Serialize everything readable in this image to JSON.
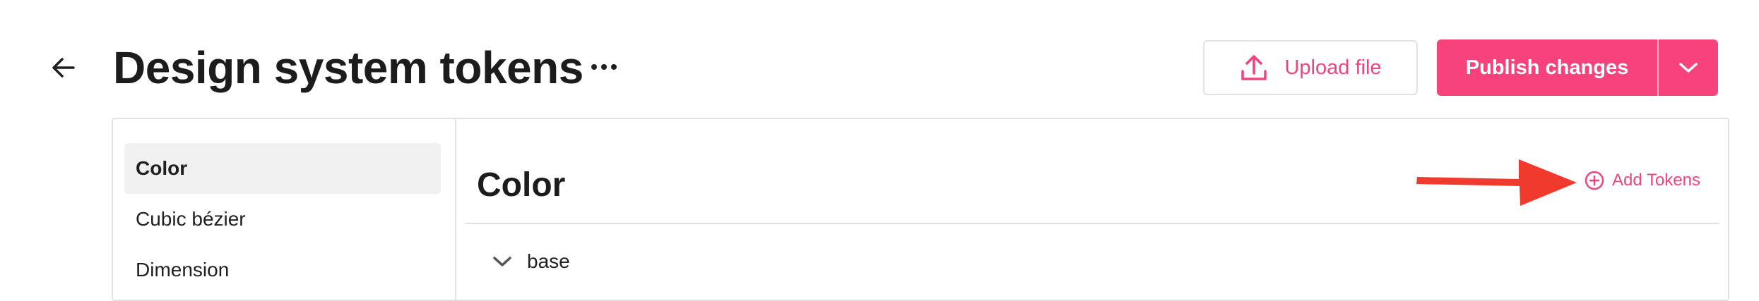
{
  "header": {
    "title": "Design system tokens",
    "more_glyph": "···",
    "upload_label": "Upload file",
    "publish_label": "Publish changes"
  },
  "sidebar": {
    "items": [
      {
        "label": "Color",
        "active": true
      },
      {
        "label": "Cubic bézier",
        "active": false
      },
      {
        "label": "Dimension",
        "active": false
      }
    ]
  },
  "main": {
    "section_title": "Color",
    "add_tokens_label": "Add Tokens",
    "groups": [
      {
        "label": "base",
        "expanded": true
      }
    ]
  },
  "colors": {
    "accent": "#f8427b",
    "annotation_arrow": "#f03a2e"
  }
}
